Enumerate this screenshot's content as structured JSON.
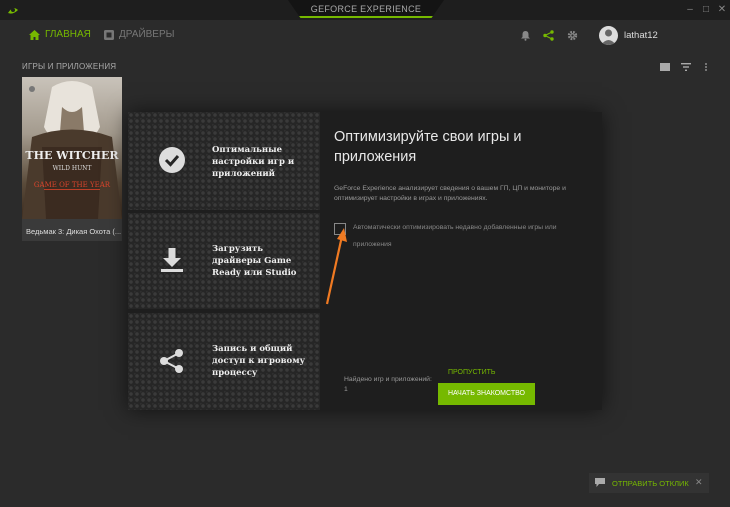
{
  "window": {
    "title": "GEFORCE EXPERIENCE",
    "controls": [
      "minimize-icon",
      "maximize-icon",
      "close-icon"
    ]
  },
  "nav": {
    "home_label": "ГЛАВНАЯ",
    "drivers_label": "ДРАЙВЕРЫ",
    "icons": [
      "bell-icon",
      "share-icon",
      "gear-icon"
    ],
    "username": "lathat12",
    "accent": "#76b900"
  },
  "library": {
    "section_title": "ИГРЫ И ПРИЛОЖЕНИЯ",
    "games": [
      {
        "name": "Ведьмак 3: Дикая Охота (...",
        "cover_title": "THE WITCHER",
        "cover_subtitle": "WILD HUNT",
        "cover_edition": "GAME OF THE YEAR"
      }
    ]
  },
  "modal": {
    "features": [
      {
        "icon": "checkmark-icon",
        "text": "Оптимальные настройки игр и приложений"
      },
      {
        "icon": "download-icon",
        "text": "Загрузить драйверы Game Ready или Studio"
      },
      {
        "icon": "share-icon",
        "text": "Запись и общий доступ к игровому процессу"
      }
    ],
    "heading": "Оптимизируйте свои игры и приложения",
    "description": "GeForce Experience анализирует сведения о вашем ГП, ЦП и мониторе и оптимизирует настройки в играх и приложениях.",
    "checkbox_label": "Автоматически оптимизировать недавно добавленные игры или приложения",
    "checkbox_checked": false,
    "found_label": "Найдено игр и приложений:",
    "found_count": "1",
    "skip_label": "ПРОПУСТИТЬ",
    "start_label": "НАЧАТЬ ЗНАКОМСТВО"
  },
  "feedback": {
    "label": "ОТПРАВИТЬ ОТКЛИК"
  }
}
